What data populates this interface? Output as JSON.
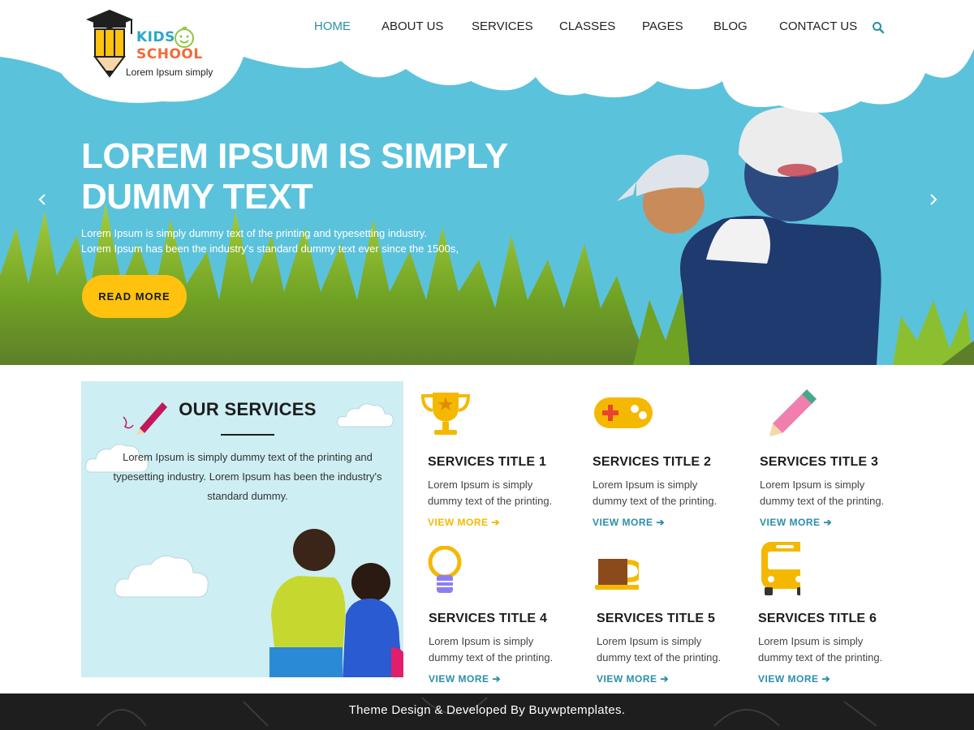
{
  "header": {
    "logo": {
      "line1": "KIDS",
      "line2": "SCHOOL",
      "tagline": "Lorem Ipsum simply"
    },
    "nav": [
      {
        "label": "HOME",
        "active": true
      },
      {
        "label": "ABOUT US",
        "active": false
      },
      {
        "label": "SERVICES",
        "active": false
      },
      {
        "label": "CLASSES",
        "active": false
      },
      {
        "label": "PAGES",
        "active": false
      },
      {
        "label": "BLOG",
        "active": false
      },
      {
        "label": "CONTACT US",
        "active": false
      }
    ],
    "search_icon": "search-icon"
  },
  "hero": {
    "title_line1": "LOREM IPSUM IS SIMPLY",
    "title_line2": "DUMMY TEXT",
    "text_line1": "Lorem Ipsum is simply dummy text of the printing and typesetting industry.",
    "text_line2": "Lorem Ipsum has been the industry's standard dummy text ever since the 1500s,",
    "button_label": "READ MORE",
    "prev_icon": "chevron-left-icon",
    "next_icon": "chevron-right-icon"
  },
  "services_panel": {
    "title": "OUR SERVICES",
    "text": "Lorem Ipsum is simply dummy text of the printing and typesetting industry. Lorem Ipsum has been the industry's standard dummy."
  },
  "services": [
    {
      "title": "SERVICES TITLE 1",
      "text_line1": "Lorem Ipsum is simply",
      "text_line2": "dummy text of the printing.",
      "link": "VIEW MORE",
      "icon": "trophy-icon"
    },
    {
      "title": "SERVICES TITLE 2",
      "text_line1": "Lorem Ipsum is simply",
      "text_line2": "dummy text of the printing.",
      "link": "VIEW MORE",
      "icon": "gamepad-icon"
    },
    {
      "title": "SERVICES TITLE 3",
      "text_line1": "Lorem Ipsum is simply",
      "text_line2": "dummy text of the printing.",
      "link": "VIEW MORE",
      "icon": "pencil-icon"
    },
    {
      "title": "SERVICES TITLE 4",
      "text_line1": "Lorem Ipsum is simply",
      "text_line2": "dummy text of the printing.",
      "link": "VIEW MORE",
      "icon": "lightbulb-icon"
    },
    {
      "title": "SERVICES TITLE 5",
      "text_line1": "Lorem Ipsum is simply",
      "text_line2": "dummy text of the printing.",
      "link": "VIEW MORE",
      "icon": "coffee-cup-icon"
    },
    {
      "title": "SERVICES TITLE 6",
      "text_line1": "Lorem Ipsum is simply",
      "text_line2": "dummy text of the printing.",
      "link": "VIEW MORE",
      "icon": "bus-icon"
    }
  ],
  "footer": {
    "text": "Theme Design & Developed By Buywptemplates."
  },
  "colors": {
    "accent": "#2a8fa8",
    "sky": "#5bc2dc",
    "button": "#ffc20e",
    "panel": "#cdeef3",
    "footer": "#1e1e1e"
  }
}
